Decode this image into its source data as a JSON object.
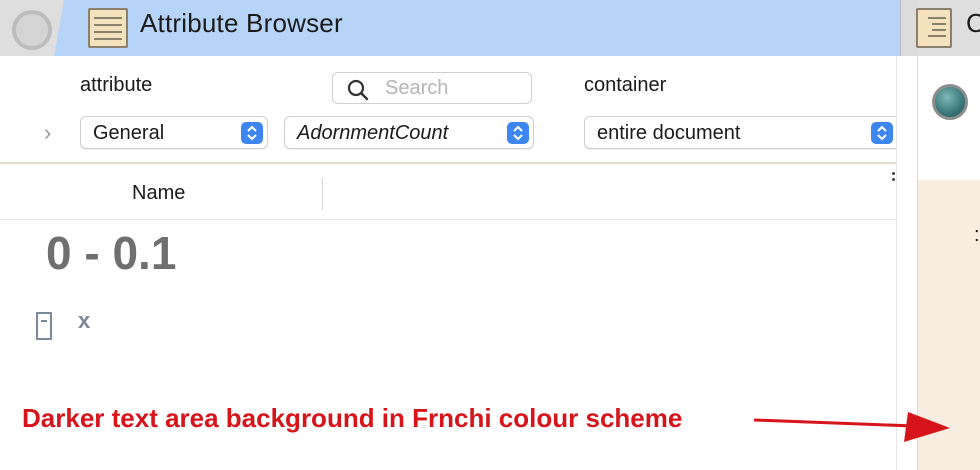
{
  "window": {
    "title": "Attribute Browser",
    "right_tab_title_partial": "C"
  },
  "toolbar": {
    "attribute_label": "attribute",
    "container_label": "container",
    "search_placeholder": "Search",
    "attribute_group_value": "General",
    "attribute_value": "AdornmentCount",
    "container_value": "entire document"
  },
  "table": {
    "column_header_name": "Name",
    "groups": [
      {
        "label": "0 - 0.1",
        "items": [
          {
            "name": "x",
            "icon": "note-icon"
          }
        ]
      }
    ]
  },
  "annotation": {
    "text": "Darker text area background in Frnchi colour scheme",
    "color": "#d6141a"
  },
  "colors": {
    "active_tab": "#b6d4f8",
    "stepper_blue": "#3d86f0",
    "text_area_background": "#f8ede0",
    "group_label": "#6f6f6f",
    "note_item": "#7b8898"
  }
}
